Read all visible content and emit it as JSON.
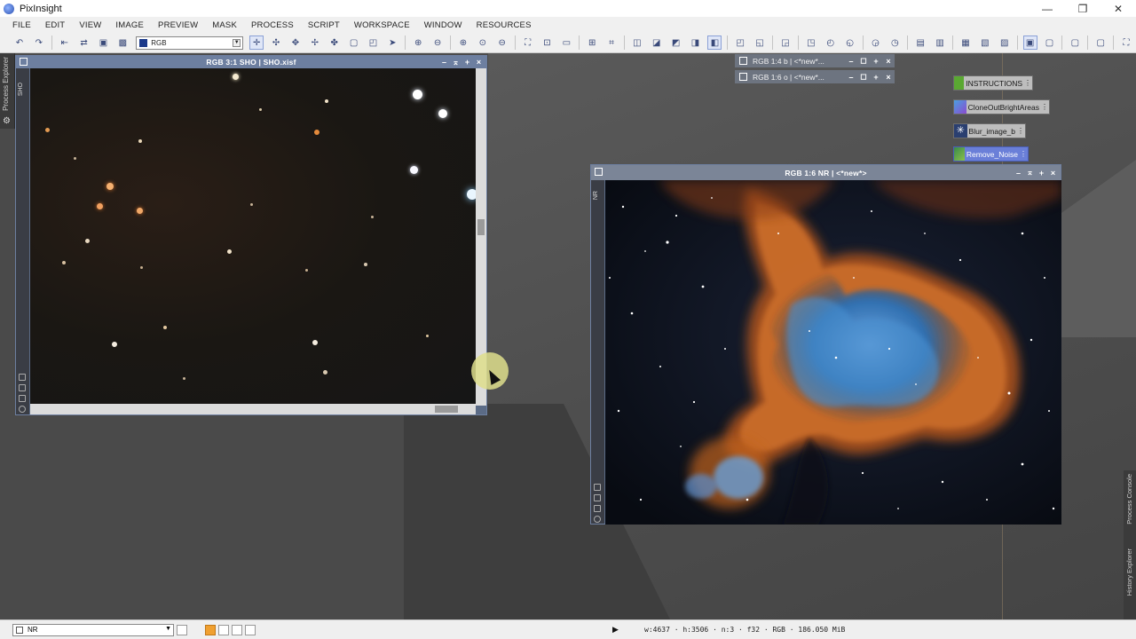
{
  "app": {
    "title": "PixInsight"
  },
  "window_controls": {
    "minimize": "—",
    "restore": "❐",
    "close": "✕"
  },
  "menu": [
    "FILE",
    "EDIT",
    "VIEW",
    "IMAGE",
    "PREVIEW",
    "MASK",
    "PROCESS",
    "SCRIPT",
    "WORKSPACE",
    "WINDOW",
    "RESOURCES"
  ],
  "toolbar": {
    "view_select_value": "RGB"
  },
  "side_tabs": {
    "left": "Process Explorer",
    "right_console": "Process Console",
    "right_history": "History Explorer"
  },
  "windows": {
    "sho": {
      "title": "RGB 3:1 SHO | SHO.xisf",
      "side_id": "SHO"
    },
    "mini1": {
      "title": "RGB 1:4 b | <*new*..."
    },
    "mini2": {
      "title": "RGB 1:6 o | <*new*..."
    },
    "nr": {
      "title": "RGB 1:6 NR | <*new*>",
      "side_id": "NR"
    }
  },
  "process_icons": [
    {
      "label": "INSTRUCTIONS",
      "icon": "pixmath-icon",
      "color": "#5aa832"
    },
    {
      "label": "CloneOutBrightAreas",
      "icon": "clone-icon",
      "color": "#6a5acd"
    },
    {
      "label": "Blur_image_b",
      "icon": "convolution-icon",
      "color": "#3a5fa8"
    },
    {
      "label": "Remove_Noise",
      "icon": "noise-icon",
      "color": "#3a8a4a",
      "selected": true
    }
  ],
  "statusbar": {
    "view_select_value": "NR",
    "info": "w:4637 · h:3506 · n:3 · f32 · RGB · 186.050 MiB"
  },
  "colors": {
    "window_title_active": "#6d7fa0",
    "window_title_inactive": "#7b8597",
    "accent": "#f0a030"
  }
}
